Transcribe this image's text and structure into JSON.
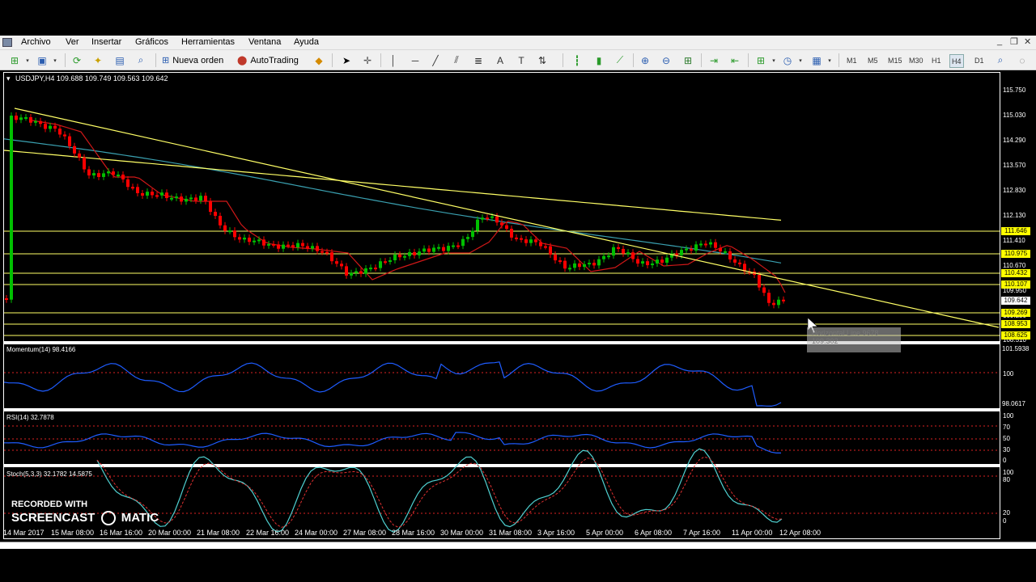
{
  "menu": {
    "items": [
      "Archivo",
      "Ver",
      "Insertar",
      "Gráficos",
      "Herramientas",
      "Ventana",
      "Ayuda"
    ]
  },
  "toolbar": {
    "new_order_label": "Nueva orden",
    "autotrading_label": "AutoTrading",
    "timeframes": [
      "M1",
      "M5",
      "M15",
      "M30",
      "H1",
      "H4",
      "D1"
    ],
    "active_timeframe": "H4"
  },
  "chart": {
    "header": "USDJPY,H4  109.688 109.749 109.563 109.642",
    "price_scale": [
      "115.750",
      "115.030",
      "114.290",
      "113.570",
      "112.830",
      "112.130",
      "111.410",
      "110.670",
      "109.950",
      "109.230",
      "108.510"
    ],
    "price_tags": {
      "yellow": [
        "111.646",
        "110.975",
        "110.432",
        "110.107",
        "109.269",
        "108.953",
        "108.625"
      ],
      "current": "109.642"
    },
    "tooltip": {
      "title": "Horizontal Line 9678",
      "value": "109.302"
    },
    "x_labels": [
      "14 Mar 2017",
      "15 Mar 08:00",
      "16 Mar 16:00",
      "20 Mar 00:00",
      "21 Mar 08:00",
      "22 Mar 16:00",
      "24 Mar 00:00",
      "27 Mar 08:00",
      "28 Mar 16:00",
      "30 Mar 00:00",
      "31 Mar 08:00",
      "3 Apr 16:00",
      "5 Apr 00:00",
      "6 Apr 08:00",
      "7 Apr 16:00",
      "11 Apr 00:00",
      "12 Apr 08:00"
    ],
    "colors": {
      "bull": "#00c000",
      "bear": "#ff0000",
      "trendline": "#ffff66",
      "ma_fast": "#d01818",
      "ma_slow": "#3aa0b0",
      "indicator": "#1e5cff"
    }
  },
  "momentum": {
    "label": "Momentum(14) 98.4166",
    "scale": [
      "101.5938",
      "100",
      "98.0617"
    ]
  },
  "rsi": {
    "label": "RSI(14) 32.7878",
    "scale": [
      "100",
      "70",
      "50",
      "30",
      "0"
    ]
  },
  "stoch": {
    "label": "Stoch(5,3,3) 32.1782 14.5875",
    "scale": [
      "100",
      "80",
      "20",
      "0"
    ]
  },
  "watermark": {
    "line1": "RECORDED WITH",
    "line2": "SCREENCAST",
    "line3": "MATIC"
  }
}
